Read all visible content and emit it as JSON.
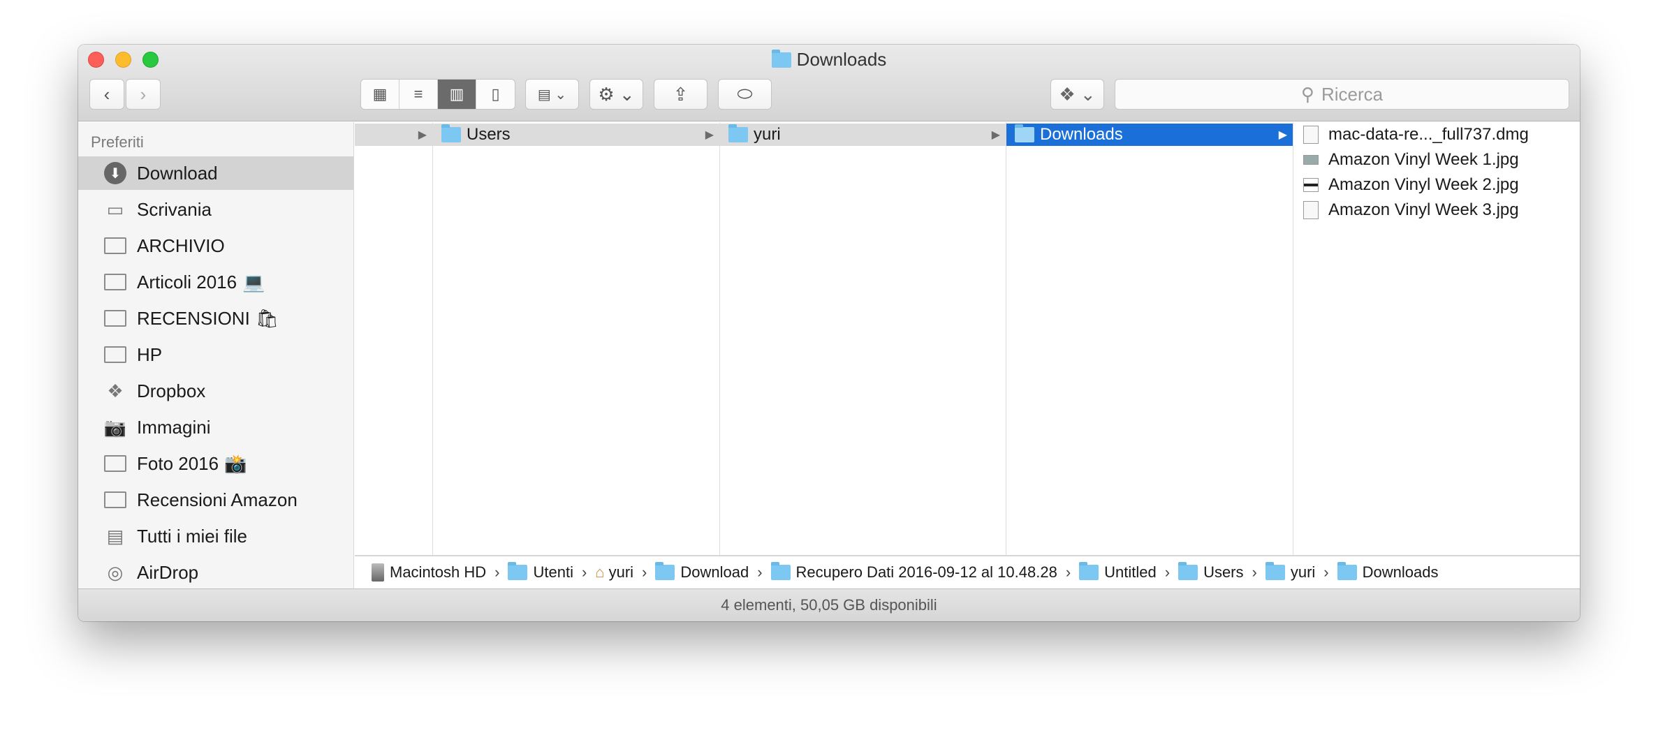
{
  "window": {
    "title": "Downloads"
  },
  "toolbar": {
    "back": "‹",
    "forward": "›",
    "view_icons": "▦",
    "view_list": "≡",
    "view_columns": "▥",
    "view_cover": "▯",
    "arrange": "▤ ⌄",
    "action": "⚙ ⌄",
    "share": "⇪",
    "tag": "⬭",
    "dropbox": "❖ ⌄",
    "search_placeholder": "Ricerca"
  },
  "sidebar": {
    "header": "Preferiti",
    "items": [
      {
        "label": "Download",
        "icon": "⬇",
        "emoji": ""
      },
      {
        "label": "Scrivania",
        "icon": "▭",
        "emoji": ""
      },
      {
        "label": "ARCHIVIO",
        "icon": "folder",
        "emoji": ""
      },
      {
        "label": "Articoli 2016",
        "icon": "folder",
        "emoji": "💻"
      },
      {
        "label": "RECENSIONI",
        "icon": "folder",
        "emoji": "🛍"
      },
      {
        "label": "HP",
        "icon": "folder",
        "emoji": ""
      },
      {
        "label": "Dropbox",
        "icon": "❖",
        "emoji": ""
      },
      {
        "label": "Immagini",
        "icon": "📷",
        "emoji": ""
      },
      {
        "label": "Foto 2016",
        "icon": "folder",
        "emoji": "📸"
      },
      {
        "label": "Recensioni Amazon",
        "icon": "folder",
        "emoji": ""
      },
      {
        "label": "Tutti i miei file",
        "icon": "▤",
        "emoji": ""
      },
      {
        "label": "AirDrop",
        "icon": "◎",
        "emoji": ""
      }
    ]
  },
  "columns": [
    {
      "label": "Users"
    },
    {
      "label": "yuri"
    },
    {
      "label": "Downloads"
    }
  ],
  "files": [
    "mac-data-re..._full737.dmg",
    "Amazon Vinyl Week 1.jpg",
    "Amazon Vinyl Week 2.jpg",
    "Amazon Vinyl Week 3.jpg"
  ],
  "path": [
    "Macintosh HD",
    "Utenti",
    "yuri",
    "Download",
    "Recupero Dati 2016-09-12 al 10.48.28",
    "Untitled",
    "Users",
    "yuri",
    "Downloads"
  ],
  "path_sep": "›",
  "status": "4 elementi, 50,05 GB disponibili"
}
